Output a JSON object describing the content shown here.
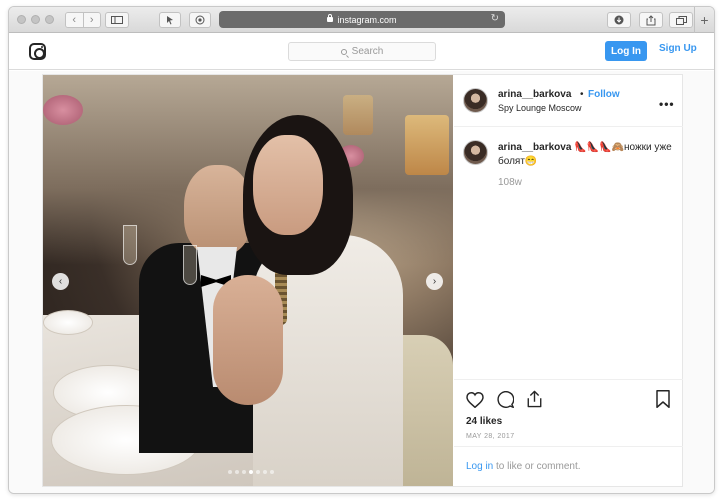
{
  "browser": {
    "url": "instagram.com",
    "new_tab": "+"
  },
  "header": {
    "search_placeholder": "Search",
    "login_label": "Log In",
    "signup_label": "Sign Up"
  },
  "post": {
    "username": "arina__barkova",
    "bullet": "•",
    "follow_label": "Follow",
    "location": "Spy Lounge Moscow",
    "more": "•••",
    "caption_user": "arina__barkova",
    "caption_text": "👠👠👠🙈ножки уже болят😁",
    "caption_time": "108w",
    "likes": "24 likes",
    "date": "MAY 28, 2017",
    "login_link": "Log in",
    "login_suffix": " to like or comment.",
    "prev_arrow": "‹",
    "next_arrow": "›",
    "carousel": {
      "count": 7,
      "active_index": 3
    }
  },
  "colors": {
    "accent": "#3897f0",
    "text": "#262626",
    "muted": "#999999"
  }
}
